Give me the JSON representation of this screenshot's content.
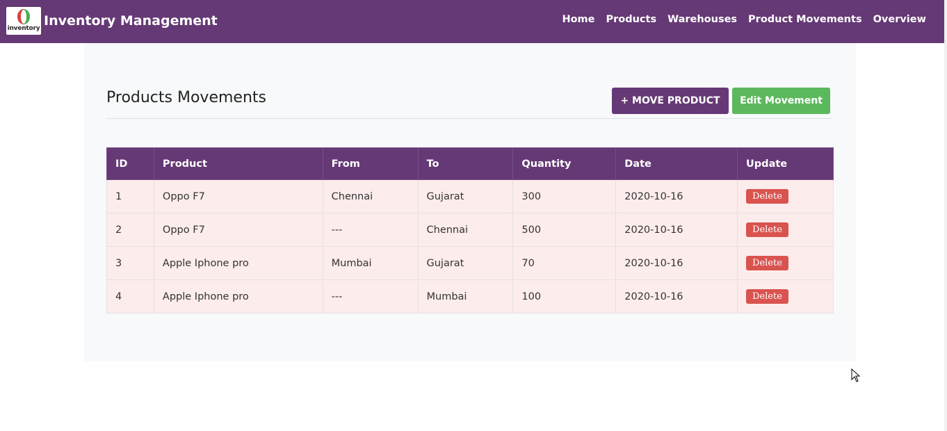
{
  "brand": {
    "logo_text": "inventory",
    "title": "Inventory Management"
  },
  "nav": {
    "items": [
      "Home",
      "Products",
      "Warehouses",
      "Product Movements",
      "Overview"
    ]
  },
  "page": {
    "title": "Products Movements",
    "move_button": "+ MOVE PRODUCT",
    "edit_button": "Edit Movement"
  },
  "table": {
    "headers": [
      "ID",
      "Product",
      "From",
      "To",
      "Quantity",
      "Date",
      "Update"
    ],
    "rows": [
      {
        "id": "1",
        "product": "Oppo F7",
        "from": "Chennai",
        "to": "Gujarat",
        "quantity": "300",
        "date": "2020-10-16",
        "action": "Delete"
      },
      {
        "id": "2",
        "product": "Oppo F7",
        "from": "---",
        "to": "Chennai",
        "quantity": "500",
        "date": "2020-10-16",
        "action": "Delete"
      },
      {
        "id": "3",
        "product": "Apple Iphone pro",
        "from": "Mumbai",
        "to": "Gujarat",
        "quantity": "70",
        "date": "2020-10-16",
        "action": "Delete"
      },
      {
        "id": "4",
        "product": "Apple Iphone pro",
        "from": "---",
        "to": "Mumbai",
        "quantity": "100",
        "date": "2020-10-16",
        "action": "Delete"
      }
    ]
  },
  "colors": {
    "navbar": "#653975",
    "move_button": "#653975",
    "edit_button": "#5cb85c",
    "delete_button": "#d9534f",
    "row_background": "#fdecec"
  },
  "icons": {
    "logo": "inventory-logo-icon",
    "cursor": "mouse-cursor-icon"
  }
}
